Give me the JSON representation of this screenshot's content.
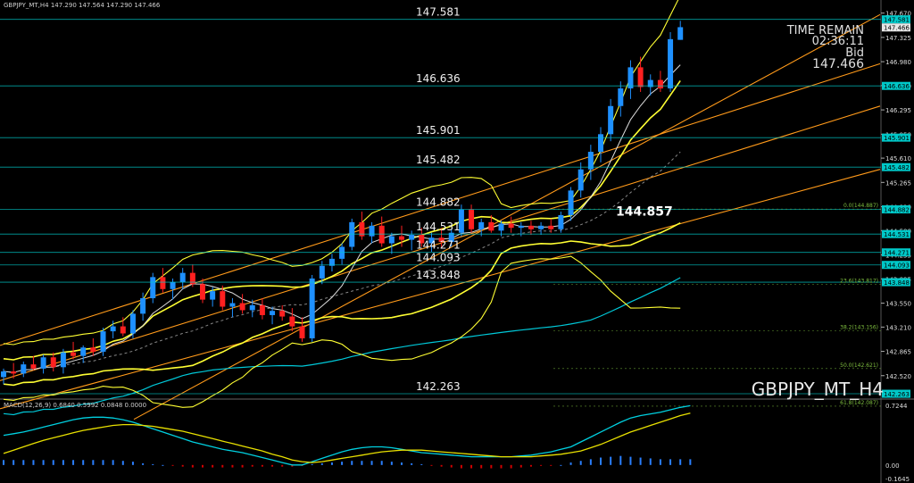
{
  "header": {
    "symbol_info": "GBPJPY_MT,H4  147.290 147.564 147.290 147.466",
    "time_remain_label": "TIME REMAIN",
    "time_remain_value": "02:36:11",
    "bid_label": "Bid",
    "bid_value": "147.466",
    "watermark": "GBPJPY_MT_H4",
    "macd_label": "MACD(12,26,9) 0.6840 0.5992 0.0848 0.0000"
  },
  "colors": {
    "background": "#000000",
    "bull": "#1e90ff",
    "bear": "#ff2020",
    "bands": "#ffff33",
    "trend": "#ff9a1a",
    "ma_cyan": "#00c8d8",
    "level_line": "#00c8c8",
    "fib": "#7fbf3f",
    "macd_hist_pos": "#2a7fff",
    "macd_hist_neg": "#d00000",
    "macd_line": "#00d0e0",
    "signal_line": "#e8e000"
  },
  "chart_data": [
    {
      "type": "candlestick",
      "title": "GBPJPY_MT_H4",
      "ylim": [
        142.2,
        147.78
      ],
      "price_axis_ticks": [
        "147.670",
        "147.325",
        "146.980",
        "146.640",
        "146.295",
        "145.950",
        "145.610",
        "145.265",
        "144.920",
        "144.580",
        "144.235",
        "143.895",
        "143.550",
        "143.210",
        "142.865",
        "142.520"
      ],
      "horizontal_levels": [
        {
          "label": "147.581",
          "value": 147.581
        },
        {
          "label": "146.636",
          "value": 146.636
        },
        {
          "label": "145.901",
          "value": 145.901
        },
        {
          "label": "145.482",
          "value": 145.482
        },
        {
          "label": "144.882",
          "value": 144.882
        },
        {
          "label": "144.531",
          "value": 144.531
        },
        {
          "label": "144.271",
          "value": 144.271
        },
        {
          "label": "144.093",
          "value": 144.093
        },
        {
          "label": "143.848",
          "value": 143.848
        },
        {
          "label": "142.263",
          "value": 142.263
        }
      ],
      "axis_tags": [
        "147.581",
        "147.466",
        "146.636",
        "145.901",
        "145.482",
        "144.882",
        "144.531",
        "144.271",
        "144.093",
        "143.848",
        "142.263"
      ],
      "fib_levels": [
        {
          "label": "0.0(144.887)",
          "value": 144.887
        },
        {
          "label": "23.6(143.817)",
          "value": 143.817
        },
        {
          "label": "38.2(143.156)",
          "value": 143.156
        },
        {
          "label": "50.0(142.621)",
          "value": 142.621
        },
        {
          "label": "61.8(142.087)",
          "value": 142.087
        }
      ],
      "annotation": {
        "label": "144.857",
        "value": 144.857
      },
      "candles": [
        [
          142.5,
          142.62,
          142.4,
          142.58
        ],
        [
          142.58,
          142.7,
          142.48,
          142.55
        ],
        [
          142.55,
          142.72,
          142.5,
          142.68
        ],
        [
          142.68,
          142.8,
          142.6,
          142.62
        ],
        [
          142.62,
          142.82,
          142.55,
          142.78
        ],
        [
          142.78,
          142.85,
          142.58,
          142.64
        ],
        [
          142.64,
          142.9,
          142.55,
          142.85
        ],
        [
          142.85,
          143.0,
          142.75,
          142.8
        ],
        [
          142.8,
          142.95,
          142.7,
          142.92
        ],
        [
          142.92,
          143.05,
          142.8,
          142.86
        ],
        [
          142.86,
          143.2,
          142.8,
          143.15
        ],
        [
          143.15,
          143.3,
          143.05,
          143.22
        ],
        [
          143.22,
          143.35,
          143.08,
          143.12
        ],
        [
          143.12,
          143.45,
          143.05,
          143.4
        ],
        [
          143.4,
          143.7,
          143.3,
          143.62
        ],
        [
          143.62,
          143.98,
          143.55,
          143.92
        ],
        [
          143.92,
          144.05,
          143.7,
          143.75
        ],
        [
          143.75,
          143.9,
          143.6,
          143.85
        ],
        [
          143.85,
          144.05,
          143.75,
          143.98
        ],
        [
          143.98,
          144.1,
          143.78,
          143.82
        ],
        [
          143.82,
          143.9,
          143.55,
          143.6
        ],
        [
          143.6,
          143.78,
          143.5,
          143.72
        ],
        [
          143.72,
          143.8,
          143.45,
          143.5
        ],
        [
          143.5,
          143.62,
          143.35,
          143.55
        ],
        [
          143.55,
          143.68,
          143.4,
          143.45
        ],
        [
          143.45,
          143.6,
          143.35,
          143.52
        ],
        [
          143.52,
          143.62,
          143.32,
          143.38
        ],
        [
          143.38,
          143.5,
          143.25,
          143.44
        ],
        [
          143.44,
          143.52,
          143.3,
          143.36
        ],
        [
          143.36,
          143.48,
          143.15,
          143.22
        ],
        [
          143.22,
          143.35,
          143.0,
          143.05
        ],
        [
          143.05,
          143.95,
          143.0,
          143.9
        ],
        [
          143.9,
          144.15,
          143.82,
          144.08
        ],
        [
          144.08,
          144.25,
          144.0,
          144.18
        ],
        [
          144.18,
          144.4,
          144.1,
          144.35
        ],
        [
          144.35,
          144.75,
          144.3,
          144.7
        ],
        [
          144.7,
          144.85,
          144.45,
          144.5
        ],
        [
          144.5,
          144.7,
          144.4,
          144.65
        ],
        [
          144.65,
          144.78,
          144.35,
          144.4
        ],
        [
          144.4,
          144.55,
          144.25,
          144.5
        ],
        [
          144.5,
          144.65,
          144.35,
          144.45
        ],
        [
          144.45,
          144.58,
          144.3,
          144.52
        ],
        [
          144.52,
          144.62,
          144.35,
          144.4
        ],
        [
          144.4,
          144.55,
          144.28,
          144.48
        ],
        [
          144.48,
          144.62,
          144.35,
          144.42
        ],
        [
          144.42,
          144.6,
          144.35,
          144.55
        ],
        [
          144.55,
          144.95,
          144.5,
          144.88
        ],
        [
          144.88,
          144.95,
          144.55,
          144.6
        ],
        [
          144.6,
          144.75,
          144.5,
          144.7
        ],
        [
          144.7,
          144.8,
          144.55,
          144.58
        ],
        [
          144.58,
          144.72,
          144.5,
          144.68
        ],
        [
          144.68,
          144.78,
          144.55,
          144.62
        ],
        [
          144.62,
          144.7,
          144.5,
          144.65
        ],
        [
          144.65,
          144.72,
          144.52,
          144.6
        ],
        [
          144.6,
          144.7,
          144.52,
          144.65
        ],
        [
          144.65,
          144.75,
          144.55,
          144.6
        ],
        [
          144.6,
          144.85,
          144.55,
          144.8
        ],
        [
          144.8,
          145.2,
          144.72,
          145.15
        ],
        [
          145.15,
          145.55,
          145.05,
          145.45
        ],
        [
          145.45,
          145.8,
          145.3,
          145.7
        ],
        [
          145.7,
          146.05,
          145.55,
          145.95
        ],
        [
          145.95,
          146.45,
          145.85,
          146.35
        ],
        [
          146.35,
          146.7,
          146.2,
          146.6
        ],
        [
          146.6,
          147.0,
          146.45,
          146.9
        ],
        [
          146.9,
          147.05,
          146.55,
          146.62
        ],
        [
          146.62,
          146.8,
          146.5,
          146.72
        ],
        [
          146.72,
          146.85,
          146.55,
          146.6
        ],
        [
          146.6,
          147.4,
          146.55,
          147.3
        ],
        [
          147.29,
          147.56,
          147.29,
          147.47
        ]
      ]
    },
    {
      "type": "bar",
      "title": "MACD(12,26,9)",
      "ylim": [
        -0.1645,
        0.7244
      ],
      "axis_ticks": [
        "0.7244",
        "0.00",
        "-0.1645"
      ],
      "series": [
        {
          "name": "0.6840",
          "values": [
            0.36,
            0.38,
            0.4,
            0.43,
            0.46,
            0.49,
            0.52,
            0.55,
            0.57,
            0.58,
            0.58,
            0.57,
            0.55,
            0.52,
            0.48,
            0.44,
            0.4,
            0.36,
            0.32,
            0.28,
            0.25,
            0.22,
            0.19,
            0.17,
            0.15,
            0.12,
            0.09,
            0.06,
            0.03,
            0.0,
            0.0,
            0.04,
            0.08,
            0.12,
            0.16,
            0.19,
            0.21,
            0.22,
            0.22,
            0.21,
            0.19,
            0.17,
            0.15,
            0.14,
            0.13,
            0.12,
            0.11,
            0.1,
            0.1,
            0.1,
            0.1,
            0.1,
            0.11,
            0.12,
            0.14,
            0.16,
            0.19,
            0.22,
            0.28,
            0.34,
            0.4,
            0.46,
            0.52,
            0.57,
            0.6,
            0.62,
            0.64,
            0.67,
            0.7,
            0.72
          ]
        },
        {
          "name": "0.5992",
          "values": [
            0.14,
            0.18,
            0.22,
            0.26,
            0.3,
            0.33,
            0.36,
            0.39,
            0.42,
            0.44,
            0.46,
            0.48,
            0.49,
            0.49,
            0.48,
            0.47,
            0.45,
            0.43,
            0.41,
            0.38,
            0.35,
            0.32,
            0.29,
            0.26,
            0.23,
            0.2,
            0.17,
            0.13,
            0.1,
            0.06,
            0.04,
            0.03,
            0.04,
            0.06,
            0.08,
            0.1,
            0.12,
            0.14,
            0.16,
            0.17,
            0.18,
            0.18,
            0.18,
            0.17,
            0.16,
            0.15,
            0.14,
            0.13,
            0.12,
            0.11,
            0.1,
            0.1,
            0.1,
            0.1,
            0.11,
            0.12,
            0.13,
            0.15,
            0.17,
            0.21,
            0.25,
            0.3,
            0.35,
            0.4,
            0.44,
            0.48,
            0.52,
            0.56,
            0.6,
            0.63
          ]
        },
        {
          "name": "0.0848",
          "values": [
            0.06,
            0.06,
            0.06,
            0.06,
            0.06,
            0.06,
            0.06,
            0.06,
            0.06,
            0.06,
            0.06,
            0.06,
            0.05,
            0.04,
            0.02,
            0.01,
            0.0,
            -0.01,
            -0.02,
            -0.03,
            -0.03,
            -0.03,
            -0.03,
            -0.03,
            -0.03,
            -0.02,
            -0.02,
            -0.02,
            -0.02,
            -0.02,
            -0.01,
            0.01,
            0.02,
            0.03,
            0.04,
            0.05,
            0.05,
            0.05,
            0.05,
            0.04,
            0.03,
            0.02,
            0.01,
            -0.01,
            -0.02,
            -0.03,
            -0.04,
            -0.04,
            -0.04,
            -0.04,
            -0.04,
            -0.04,
            -0.03,
            -0.02,
            -0.01,
            -0.01,
            0.0,
            0.03,
            0.05,
            0.07,
            0.09,
            0.1,
            0.11,
            0.1,
            0.09,
            0.08,
            0.07,
            0.07,
            0.07,
            0.07
          ]
        }
      ]
    }
  ]
}
